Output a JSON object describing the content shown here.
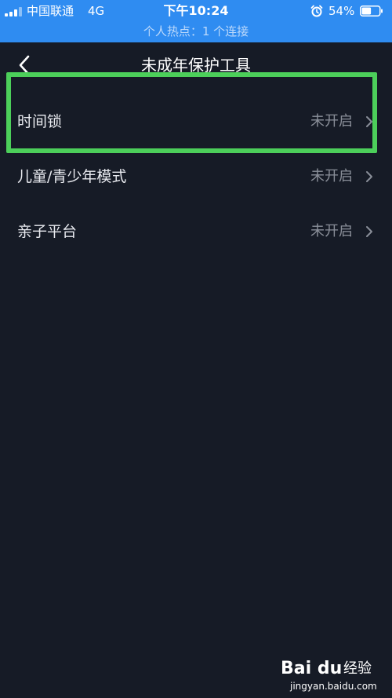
{
  "status_bar": {
    "carrier": "中国联通",
    "network": "4G",
    "time": "下午10:24",
    "battery_percent": "54%",
    "battery_level": 0.54,
    "hotspot_text": "个人热点：1 个连接",
    "background_color": "#2f8cf1"
  },
  "header": {
    "title": "未成年保护工具",
    "back_icon": "chevron-left-icon"
  },
  "list": {
    "items": [
      {
        "label": "时间锁",
        "value": "未开启",
        "icon": "chevron-right-icon"
      },
      {
        "label": "儿童/青少年模式",
        "value": "未开启",
        "icon": "chevron-right-icon"
      },
      {
        "label": "亲子平台",
        "value": "未开启",
        "icon": "chevron-right-icon"
      }
    ]
  },
  "highlight": {
    "color": "#4ccf5a",
    "target": "时间锁"
  },
  "watermark": {
    "logo": "Bai du",
    "brand": "经验",
    "url": "jingyan.baidu.com"
  },
  "theme": {
    "background": "#161b26",
    "text": "#e9ebf0",
    "muted": "#8a8f99"
  }
}
